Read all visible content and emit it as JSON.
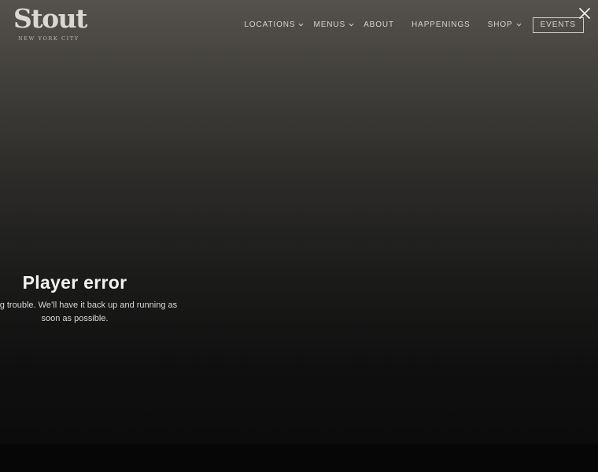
{
  "brand": {
    "name": "Stout",
    "tagline": "NEW YORK CITY"
  },
  "nav": {
    "items": [
      {
        "label": "LOCATIONS",
        "dropdown": true
      },
      {
        "label": "MENUS",
        "dropdown": true
      },
      {
        "label": "ABOUT",
        "dropdown": false
      },
      {
        "label": "HAPPENINGS",
        "dropdown": false
      },
      {
        "label": "SHOP",
        "dropdown": true
      }
    ],
    "cta_label": "EVENTS"
  },
  "player": {
    "error_title": "Player error",
    "error_message_line1": "s having trouble. We’ll have it back up and running as",
    "error_message_line2": "soon as possible."
  },
  "icons": {
    "close": "close-icon",
    "caret": "chevron-down-icon"
  },
  "colors": {
    "nav_text": "#d6d4cf",
    "background_top": "#55524d",
    "background_bottom": "#0b0b0b",
    "error_text": "#f2f2f2"
  }
}
